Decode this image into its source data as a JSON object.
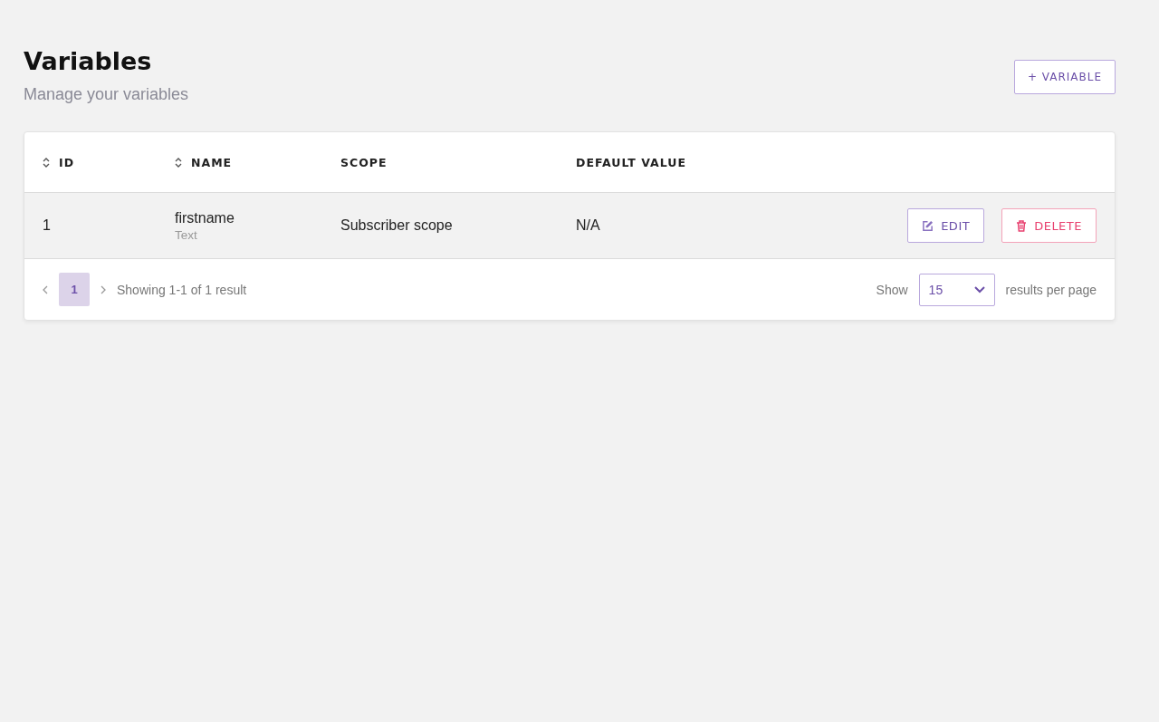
{
  "header": {
    "title": "Variables",
    "subtitle": "Manage your variables",
    "add_button": "+ VARIABLE"
  },
  "table": {
    "columns": [
      {
        "label": "ID",
        "sortable": true
      },
      {
        "label": "NAME",
        "sortable": true
      },
      {
        "label": "SCOPE",
        "sortable": false
      },
      {
        "label": "DEFAULT VALUE",
        "sortable": false
      }
    ],
    "rows": [
      {
        "id": "1",
        "name": "firstname",
        "type": "Text",
        "scope": "Subscriber scope",
        "default_value": "N/A",
        "actions": [
          {
            "kind": "edit",
            "label": "EDIT"
          },
          {
            "kind": "delete",
            "label": "DELETE"
          }
        ]
      }
    ]
  },
  "pagination": {
    "pages": [
      {
        "label": "1",
        "selected": true
      }
    ],
    "summary": "Showing 1-1 of 1 result",
    "show_label": "Show",
    "per_page": "15",
    "per_page_suffix": "results per page"
  }
}
